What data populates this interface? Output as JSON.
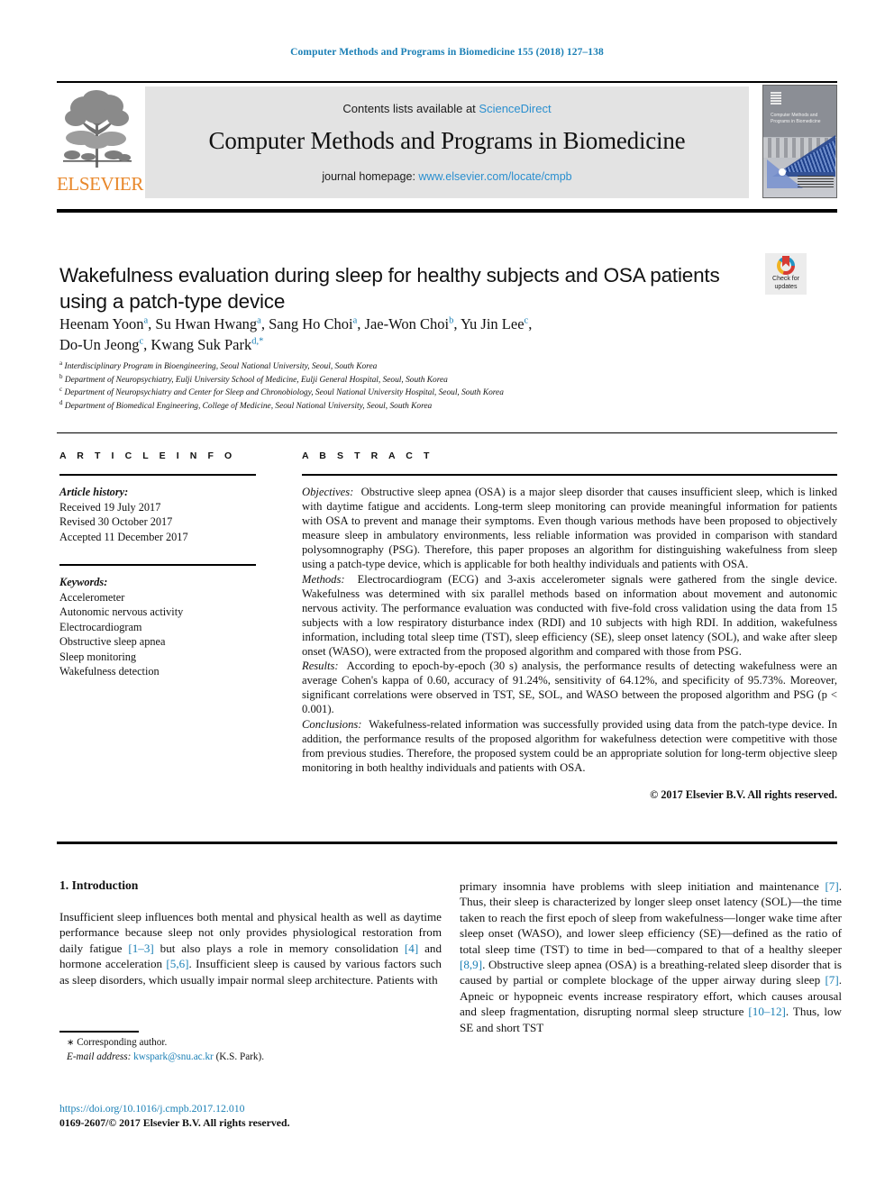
{
  "running_head": "Computer Methods and Programs in Biomedicine 155 (2018) 127–138",
  "banner": {
    "publisher_name": "ELSEVIER",
    "contents_prefix": "Contents lists available at ",
    "contents_link": "ScienceDirect",
    "journal_title": "Computer Methods and Programs in Biomedicine",
    "homepage_prefix": "journal homepage: ",
    "homepage_link": "www.elsevier.com/locate/cmpb",
    "cover_title": "Computer Methods and Programs in Biomedicine"
  },
  "article": {
    "title": "Wakefulness evaluation during sleep for healthy subjects and OSA patients using a patch-type device",
    "authors_line1": "Heenam Yoon<sup>a</sup>, Su Hwan Hwang<sup>a</sup>, Sang Ho Choi<sup>a</sup>, Jae-Won Choi<sup>b</sup>, Yu Jin Lee<sup>c</sup>,",
    "authors_line2": "Do-Un Jeong<sup>c</sup>, Kwang Suk Park<sup>d,*</sup>",
    "affiliations": [
      "<sup>a</sup> Interdisciplinary Program in Bioengineering, Seoul National University, Seoul, South Korea",
      "<sup>b</sup> Department of Neuropsychiatry, Eulji University School of Medicine, Eulji General Hospital, Seoul, South Korea",
      "<sup>c</sup> Department of Neuropsychiatry and Center for Sleep and Chronobiology, Seoul National University Hospital, Seoul, South Korea",
      "<sup>d</sup> Department of Biomedical Engineering, College of Medicine, Seoul National University, Seoul, South Korea"
    ]
  },
  "crossmark": {
    "line1": "Check for",
    "line2": "updates"
  },
  "article_info": {
    "heading": "A R T I C L E   I N F O",
    "history_label": "Article history:",
    "history": [
      "Received 19 July 2017",
      "Revised 30 October 2017",
      "Accepted 11 December 2017"
    ],
    "keywords_label": "Keywords:",
    "keywords": [
      "Accelerometer",
      "Autonomic nervous activity",
      "Electrocardiogram",
      "Obstructive sleep apnea",
      "Sleep monitoring",
      "Wakefulness detection"
    ]
  },
  "abstract": {
    "heading": "A B S T R A C T",
    "objectives_label": "Objectives:",
    "objectives_text": "Obstructive sleep apnea (OSA) is a major sleep disorder that causes insufficient sleep, which is linked with daytime fatigue and accidents. Long-term sleep monitoring can provide meaningful information for patients with OSA to prevent and manage their symptoms. Even though various methods have been proposed to objectively measure sleep in ambulatory environments, less reliable information was provided in comparison with standard polysomnography (PSG). Therefore, this paper proposes an algorithm for distinguishing wakefulness from sleep using a patch-type device, which is applicable for both healthy individuals and patients with OSA.",
    "methods_label": "Methods:",
    "methods_text": "Electrocardiogram (ECG) and 3-axis accelerometer signals were gathered from the single device. Wakefulness was determined with six parallel methods based on information about movement and autonomic nervous activity. The performance evaluation was conducted with five-fold cross validation using the data from 15 subjects with a low respiratory disturbance index (RDI) and 10 subjects with high RDI. In addition, wakefulness information, including total sleep time (TST), sleep efficiency (SE), sleep onset latency (SOL), and wake after sleep onset (WASO), were extracted from the proposed algorithm and compared with those from PSG.",
    "results_label": "Results:",
    "results_text": "According to epoch-by-epoch (30 s) analysis, the performance results of detecting wakefulness were an average Cohen's kappa of 0.60, accuracy of 91.24%, sensitivity of 64.12%, and specificity of 95.73%. Moreover, significant correlations were observed in TST, SE, SOL, and WASO between the proposed algorithm and PSG (p < 0.001).",
    "conclusions_label": "Conclusions:",
    "conclusions_text": "Wakefulness-related information was successfully provided using data from the patch-type device. In addition, the performance results of the proposed algorithm for wakefulness detection were competitive with those from previous studies. Therefore, the proposed system could be an appropriate solution for long-term objective sleep monitoring in both healthy individuals and patients with OSA.",
    "copyright": "© 2017 Elsevier B.V. All rights reserved."
  },
  "introduction": {
    "section_title": "1. Introduction",
    "paragraph_left": "Insufficient sleep influences both mental and physical health as well as daytime performance because sleep not only provides physiological restoration from daily fatigue [1–3] but also plays a role in memory consolidation [4] and hormone acceleration [5,6]. Insufficient sleep is caused by various factors such as sleep disorders, which usually impair normal sleep architecture. Patients with",
    "paragraph_right": "primary insomnia have problems with sleep initiation and maintenance [7]. Thus, their sleep is characterized by longer sleep onset latency (SOL)—the time taken to reach the first epoch of sleep from wakefulness—longer wake time after sleep onset (WASO), and lower sleep efficiency (SE)—defined as the ratio of total sleep time (TST) to time in bed—compared to that of a healthy sleeper [8,9]. Obstructive sleep apnea (OSA) is a breathing-related sleep disorder that is caused by partial or complete blockage of the upper airway during sleep [7]. Apneic or hypopneic events increase respiratory effort, which causes arousal and sleep fragmentation, disrupting normal sleep structure [10–12]. Thus, low SE and short TST"
  },
  "footer": {
    "corresponding_author": "Corresponding author.",
    "email_label": "E-mail address:",
    "email": "kwspark@snu.ac.kr",
    "email_suffix": "(K.S. Park).",
    "doi": "https://doi.org/10.1016/j.cmpb.2017.12.010",
    "issn_line": "0169-2607/© 2017 Elsevier B.V. All rights reserved."
  },
  "colors": {
    "link": "#1a7fb5",
    "banner_bg": "#e3e3e3",
    "elsevier_orange": "#E8872A"
  }
}
